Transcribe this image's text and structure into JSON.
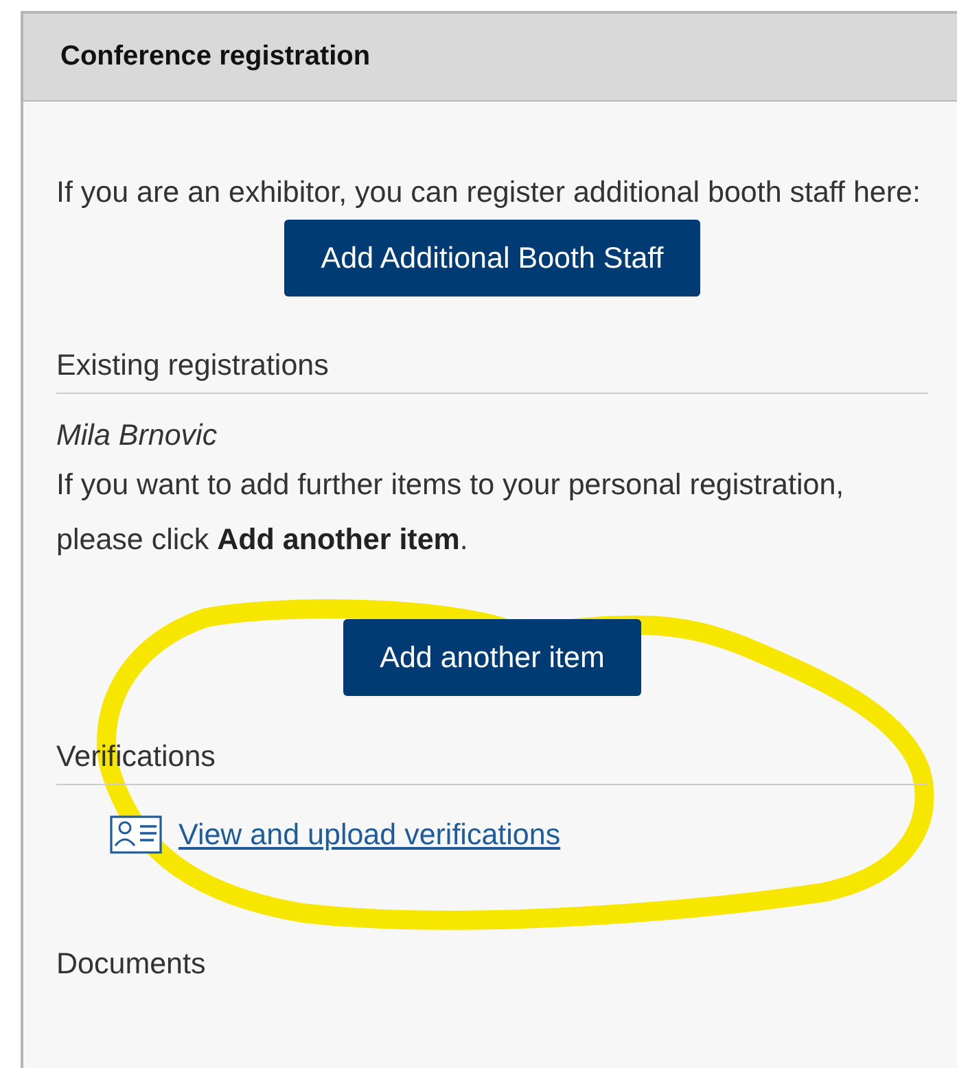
{
  "panel": {
    "title": "Conference registration"
  },
  "intro": {
    "text": "If you are an exhibitor, you can register additional booth staff here:",
    "button": "Add Additional Booth Staff"
  },
  "sections": [
    {
      "kind": "registrations",
      "heading": "Existing registrations",
      "name": "Mila Brnovic",
      "text": "If you want to add further items to your personal registration, please click **Add another item**.",
      "button": "Add another item"
    },
    {
      "kind": "verifications",
      "heading": "Verifications",
      "link": "View and upload verifications"
    },
    {
      "kind": "documents",
      "heading": "Documents"
    }
  ],
  "annotation": {
    "kind": "highlight"
  }
}
